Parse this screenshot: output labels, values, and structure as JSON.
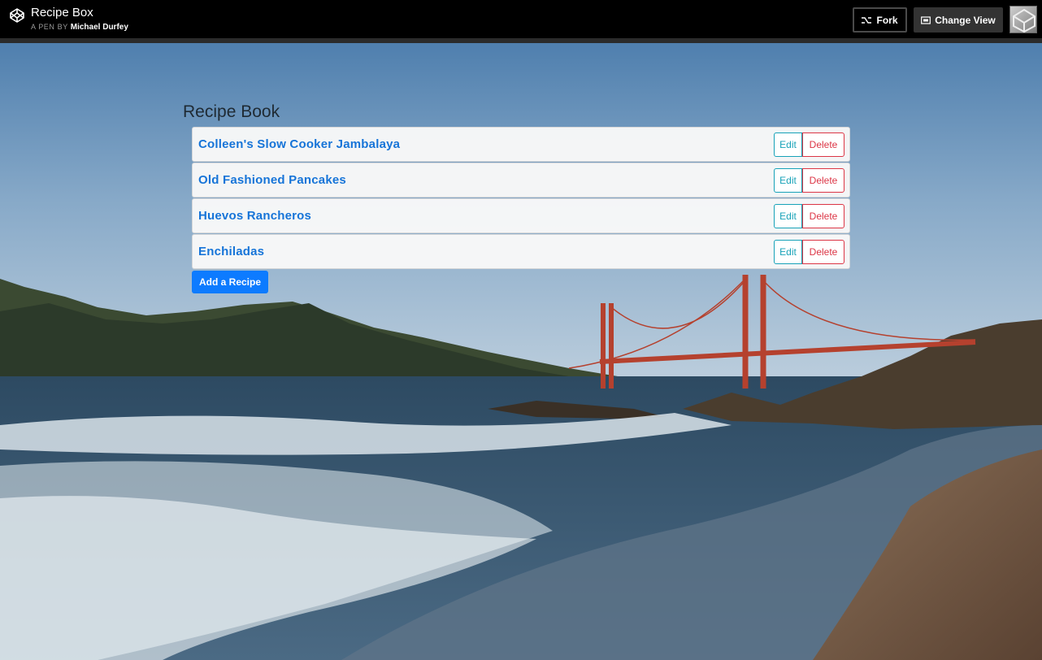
{
  "header": {
    "title": "Recipe Box",
    "byline_prefix": "A PEN BY",
    "author": "Michael Durfey",
    "fork_label": "Fork",
    "change_view_label": "Change View"
  },
  "main": {
    "heading": "Recipe Book",
    "recipes": [
      {
        "name": "Colleen's Slow Cooker Jambalaya",
        "edit": "Edit",
        "delete": "Delete"
      },
      {
        "name": "Old Fashioned Pancakes",
        "edit": "Edit",
        "delete": "Delete"
      },
      {
        "name": "Huevos Rancheros",
        "edit": "Edit",
        "delete": "Delete"
      },
      {
        "name": "Enchiladas",
        "edit": "Edit",
        "delete": "Delete"
      }
    ],
    "add_label": "Add a Recipe"
  },
  "colors": {
    "link": "#1674d8",
    "edit": "#17a2b8",
    "delete": "#dc3545",
    "primary": "#0d7bff"
  },
  "icons": [
    "codepen-logo-icon",
    "fork-icon",
    "change-view-icon",
    "avatar"
  ]
}
